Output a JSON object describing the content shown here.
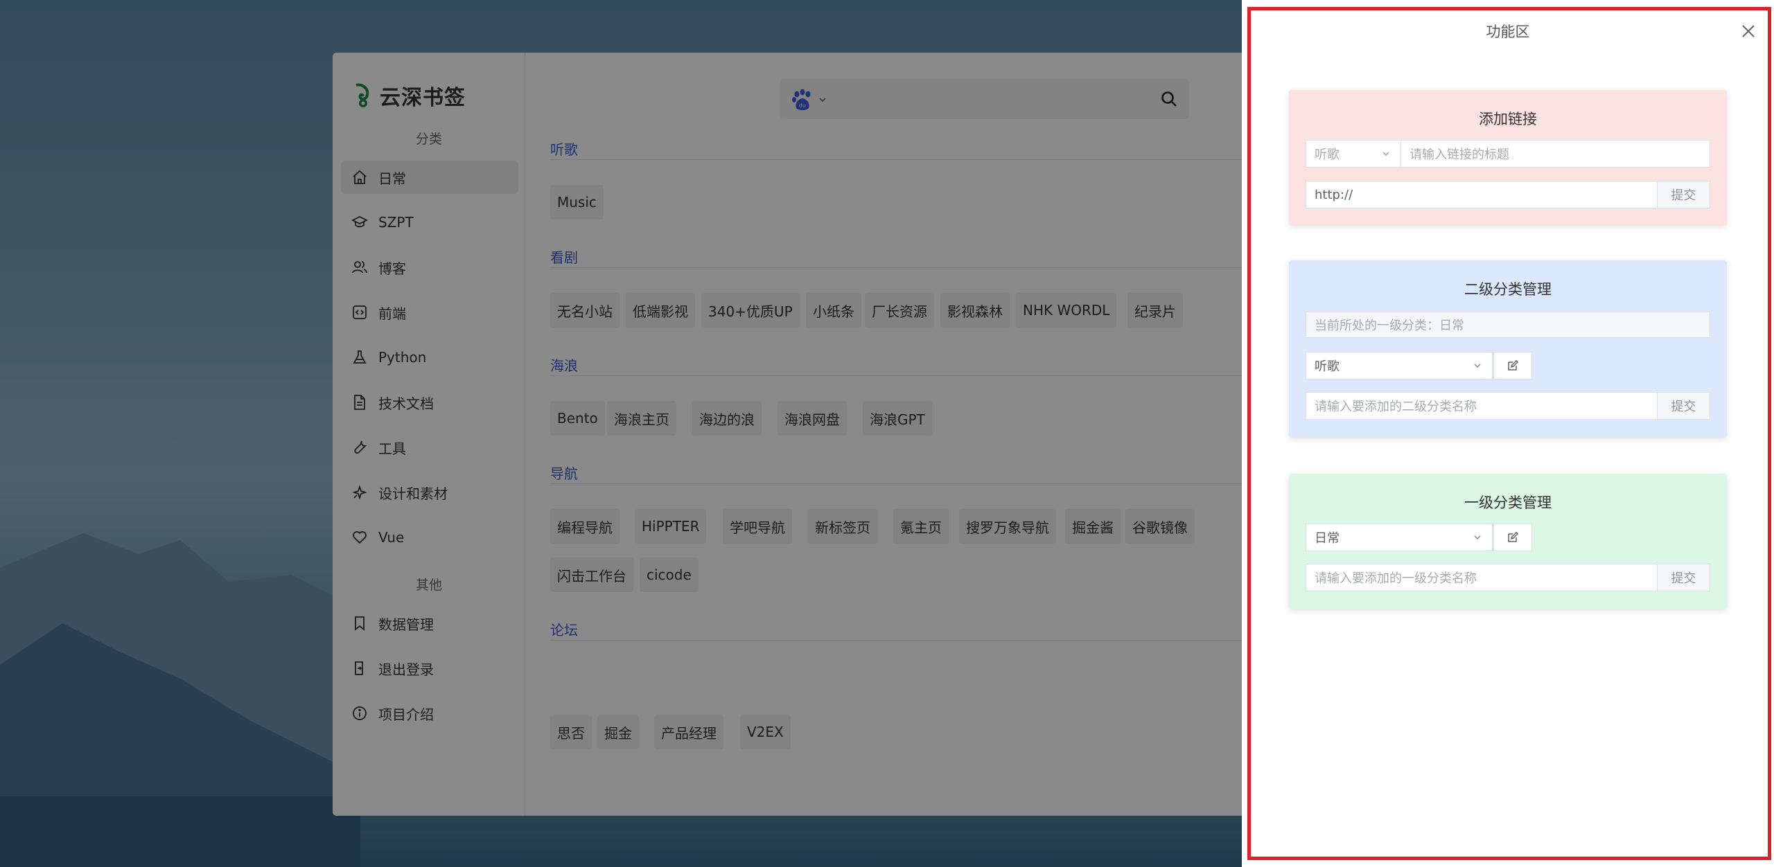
{
  "app": {
    "brand": "云深书签",
    "groups": [
      "分类",
      "其他"
    ],
    "nav": [
      {
        "label": "日常",
        "icon": "home-icon"
      },
      {
        "label": "SZPT",
        "icon": "graduation-cap-icon"
      },
      {
        "label": "博客",
        "icon": "users-icon"
      },
      {
        "label": "前端",
        "icon": "code-icon"
      },
      {
        "label": "Python",
        "icon": "flask-icon"
      },
      {
        "label": "技术文档",
        "icon": "document-icon"
      },
      {
        "label": "工具",
        "icon": "wrench-icon"
      },
      {
        "label": "设计和素材",
        "icon": "sparkle-icon"
      },
      {
        "label": "Vue",
        "icon": "heart-icon"
      }
    ],
    "other_nav": [
      {
        "label": "数据管理",
        "icon": "bookmark-icon"
      },
      {
        "label": "退出登录",
        "icon": "logout-icon"
      },
      {
        "label": "项目介绍",
        "icon": "info-icon"
      }
    ],
    "search": {
      "engine_icon": "baidu-paw-icon"
    },
    "sections": [
      {
        "title": "听歌",
        "tags": [
          "Music"
        ]
      },
      {
        "title": "看剧",
        "tags": [
          "无名小站",
          "低端影视",
          "340+优质UP",
          "小纸条",
          "厂长资源",
          "影视森林",
          "NHK WORDL",
          "纪录片"
        ]
      },
      {
        "title": "海浪",
        "tags": [
          "Bento",
          "海浪主页",
          "海边的浪",
          "海浪网盘",
          "海浪GPT"
        ]
      },
      {
        "title": "导航",
        "tags": [
          "编程导航",
          "HiPPTER",
          "学吧导航",
          "新标签页",
          "氪主页",
          "搜罗万象导航",
          "掘金酱",
          "谷歌镜像",
          "闪击工作台",
          "cicode"
        ]
      },
      {
        "title": "论坛",
        "tags": [
          "思否",
          "掘金",
          "产品经理",
          "V2EX"
        ]
      }
    ]
  },
  "drawer": {
    "title": "功能区",
    "add_link": {
      "title": "添加链接",
      "category_select": "听歌",
      "title_placeholder": "请输入链接的标题",
      "url_value": "http://",
      "submit": "提交",
      "color": "#fde2e2"
    },
    "secondary": {
      "title": "二级分类管理",
      "current_primary": "当前所处的一级分类：日常",
      "select": "听歌",
      "name_placeholder": "请输入要添加的二级分类名称",
      "submit": "提交",
      "color": "#dbe8fd"
    },
    "primary": {
      "title": "一级分类管理",
      "select": "日常",
      "name_placeholder": "请输入要添加的一级分类名称",
      "submit": "提交",
      "color": "#dcf7e3"
    }
  }
}
